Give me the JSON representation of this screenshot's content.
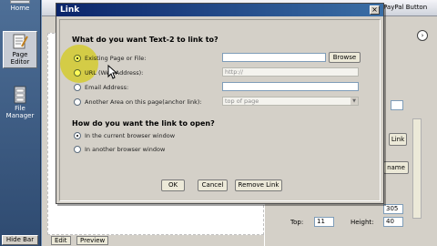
{
  "sidebar": {
    "items": [
      {
        "label": "Home",
        "icon": "home-icon"
      },
      {
        "label": "Page Editor",
        "icon": "page-editor-icon",
        "selected": true
      },
      {
        "label": "File Manager",
        "icon": "file-manager-icon"
      }
    ],
    "hide_bar": "Hide Bar"
  },
  "editor": {
    "paypal_button": "PayPal Button",
    "tabs": [
      "Edit",
      "Preview"
    ],
    "side_link_button": "Link",
    "side_rename_button": "name",
    "fields": {
      "top_label": "Top:",
      "top_value": "11",
      "height_label": "Height:",
      "height_value": "40",
      "width_value": "305"
    }
  },
  "dialog": {
    "title": "Link",
    "section1": "What do you want Text-2 to link to?",
    "options": [
      {
        "label": "Existing Page or File:",
        "checked": true
      },
      {
        "label": "URL (Web Address):",
        "checked": false
      },
      {
        "label": "Email Address:",
        "checked": false
      },
      {
        "label": "Another Area on this page(anchor link):",
        "checked": false
      }
    ],
    "browse_button": "Browse",
    "url_placeholder": "http://",
    "anchor_select": "top of page",
    "section2": "How do you want the link to open?",
    "open_options": [
      {
        "label": "In the current browser window",
        "checked": true
      },
      {
        "label": "In another browser window",
        "checked": false
      }
    ],
    "buttons": {
      "ok": "OK",
      "cancel": "Cancel",
      "remove": "Remove Link"
    }
  },
  "colors": {
    "title_bar": "#0a246a",
    "dialog_bg": "#d4d0c8",
    "highlight": "#fffa3c",
    "sidebar": "#3e5c84"
  }
}
